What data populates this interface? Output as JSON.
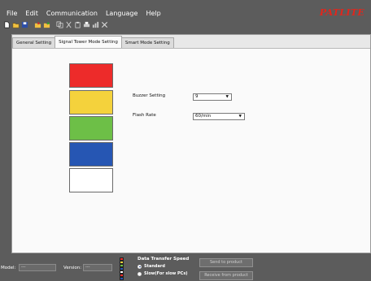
{
  "menu": {
    "items": [
      "File",
      "Edit",
      "Communication",
      "Language",
      "Help"
    ],
    "brand": "PATLITE"
  },
  "toolbar": {
    "icons": [
      "new-file-icon",
      "open-folder-icon",
      "save-icon",
      "save-as-icon",
      "export-icon",
      "copy-icon",
      "cut-icon",
      "paste-icon",
      "print-icon",
      "chart-icon",
      "delete-icon"
    ]
  },
  "tabs": [
    {
      "label": "General Setting"
    },
    {
      "label": "Signal Tower Mode Setting"
    },
    {
      "label": "Smart Mode Setting"
    }
  ],
  "active_tab": "Signal Tower Mode Setting",
  "tower": {
    "lamps": [
      {
        "name": "red",
        "color": "#ed2b2a"
      },
      {
        "name": "yellow",
        "color": "#f4d23c"
      },
      {
        "name": "green",
        "color": "#6dbf47"
      },
      {
        "name": "blue",
        "color": "#2656b3"
      },
      {
        "name": "white",
        "color": "#ffffff"
      }
    ]
  },
  "settings": {
    "buzzer_label": "Buzzer Setting",
    "buzzer_value": "9",
    "flash_label": "Flash Rate",
    "flash_value": "60/min"
  },
  "status": {
    "model_label": "Model:",
    "model_value": "---",
    "version_label": "Version:",
    "version_value": "---",
    "speed_title": "Data Transfer Speed",
    "speed_options": [
      "Standard",
      "Slow(For slow PCs)"
    ],
    "speed_selected": "Standard",
    "send_label": "Send to product",
    "receive_label": "Receive from product"
  }
}
